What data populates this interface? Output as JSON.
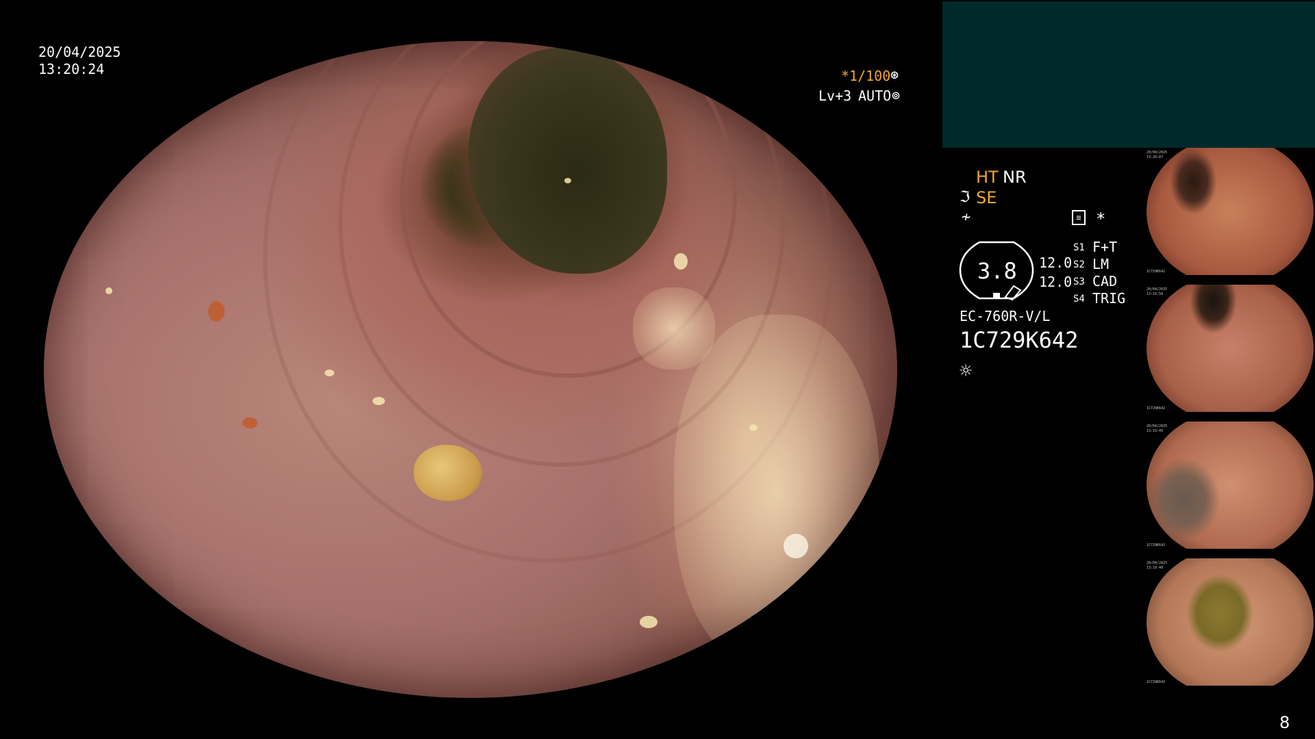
{
  "header": {
    "date": "20/04/2025",
    "time": "13:20:24"
  },
  "shutter": {
    "speed": "*1/100",
    "speed_icon": "iris-icon",
    "level": "Lv+3",
    "mode": "AUTO",
    "mode_icon": "auto-exposure-icon"
  },
  "image_settings": {
    "ht": "HT",
    "nr": "NR",
    "se": "SE",
    "se_icon": "scope-enhance-icon",
    "freeze_icon": "freeze-icon",
    "record_icon": "recording-icon",
    "asterisk": "*"
  },
  "scope": {
    "gauge_value": "3.8",
    "val1": "12.0",
    "val2": "12.0",
    "model": "EC-760R-V/L",
    "serial": "1C729K642",
    "light_icon": "light-source-icon"
  },
  "switches": [
    {
      "key": "S1",
      "value": "F+T"
    },
    {
      "key": "S2",
      "value": "LM"
    },
    {
      "key": "S3",
      "value": "CAD"
    },
    {
      "key": "S4",
      "value": "TRIG"
    }
  ],
  "thumbnails": [
    {
      "date": "20/04/2025",
      "time": "13:20:07",
      "serial": "1C729K642"
    },
    {
      "date": "20/04/2025",
      "time": "13:19:58",
      "serial": "1C729K642"
    },
    {
      "date": "20/04/2025",
      "time": "13:19:49",
      "serial": "1C729K642"
    },
    {
      "date": "20/04/2025",
      "time": "13:19:40",
      "serial": "1C729K642"
    }
  ],
  "page_number": "8",
  "colors": {
    "accent": "#f4a830",
    "panel": "#00292b",
    "text": "#ffffff"
  }
}
